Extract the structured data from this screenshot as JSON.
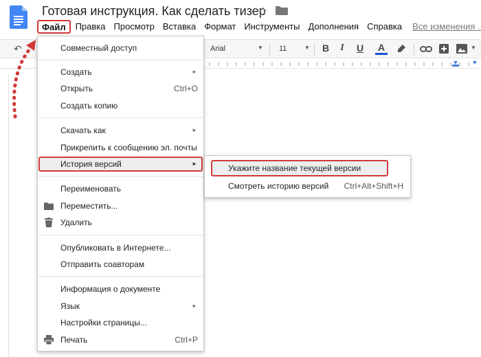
{
  "header": {
    "title": "Готовая инструкция. Как сделать тизер",
    "star_icon": "star-icon",
    "folder_icon": "folder-icon"
  },
  "menubar": {
    "items": [
      "Файл",
      "Правка",
      "Просмотр",
      "Вставка",
      "Формат",
      "Инструменты",
      "Дополнения",
      "Справка"
    ],
    "changes_link": "Все изменения ..."
  },
  "toolbar": {
    "font": "Arial",
    "size": "11",
    "bold": "B",
    "italic": "I",
    "underline": "U",
    "text_color": "A"
  },
  "file_menu": {
    "share": "Совместный доступ",
    "create": "Создать",
    "open": "Открыть",
    "open_shortcut": "Ctrl+O",
    "copy": "Создать копию",
    "download": "Скачать как",
    "attach": "Прикрепить к сообщению эл. почты",
    "history": "История версий",
    "rename": "Переименовать",
    "move": "Переместить...",
    "delete": "Удалить",
    "publish": "Опубликовать в Интернете...",
    "send": "Отправить соавторам",
    "info": "Информация о документе",
    "language": "Язык",
    "page_setup": "Настройки страницы...",
    "print": "Печать",
    "print_shortcut": "Ctrl+P"
  },
  "history_submenu": {
    "name_version": "Укажите название текущей версии",
    "see_history": "Смотреть историю версий",
    "see_history_shortcut": "Ctrl+Alt+Shift+H"
  },
  "colors": {
    "highlight": "#d03a3a",
    "docs_blue": "#4285f4",
    "text_color_bar": "#1a4fd0"
  }
}
